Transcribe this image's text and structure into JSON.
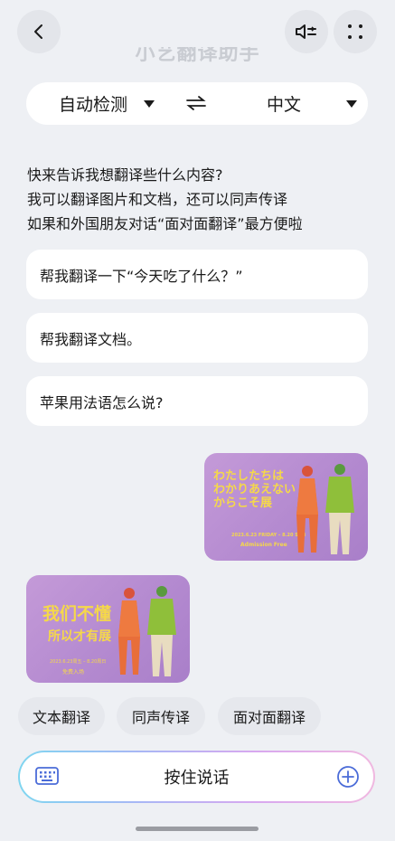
{
  "header": {
    "title": "小艺翻译助手",
    "back_icon": "chevron-left-icon",
    "audio_icon": "speaker-mute-icon",
    "scan_icon": "scan-frame-icon"
  },
  "language_bar": {
    "source": "自动检测",
    "target": "中文",
    "swap_icon": "swap-arrows-icon"
  },
  "intro": {
    "line1": "快来告诉我想翻译些什么内容?",
    "line2": "我可以翻译图片和文档，还可以同声传译",
    "line3": "如果和外国朋友对话“面对面翻译”最方便啦"
  },
  "suggestions": [
    {
      "label": "帮我翻译一下“今天吃了什么？”"
    },
    {
      "label": "帮我翻译文档。"
    },
    {
      "label": "苹果用法语怎么说?"
    }
  ],
  "sent_image": {
    "title_jp": [
      "わたしたちは",
      "わかりあえない",
      "からこそ展"
    ],
    "date": "2023.6.23 FRIDAY – 8.20 SUN",
    "admission": "Admission Free"
  },
  "translated_image": {
    "title_line1": "我们不懂",
    "title_line2": "所以才有展",
    "date": "2023.6.23周五 – 8.20周日",
    "admission": "免费入场"
  },
  "chips": [
    {
      "label": "文本翻译"
    },
    {
      "label": "同声传译"
    },
    {
      "label": "面对面翻译"
    }
  ],
  "input": {
    "hold_to_talk": "按住说话",
    "keyboard_icon": "keyboard-icon",
    "add_icon": "plus-circle-icon"
  },
  "colors": {
    "background": "#eef0f4",
    "card": "#ffffff",
    "poster_purple": "#b48ad0",
    "poster_yellow": "#f5d84a"
  }
}
